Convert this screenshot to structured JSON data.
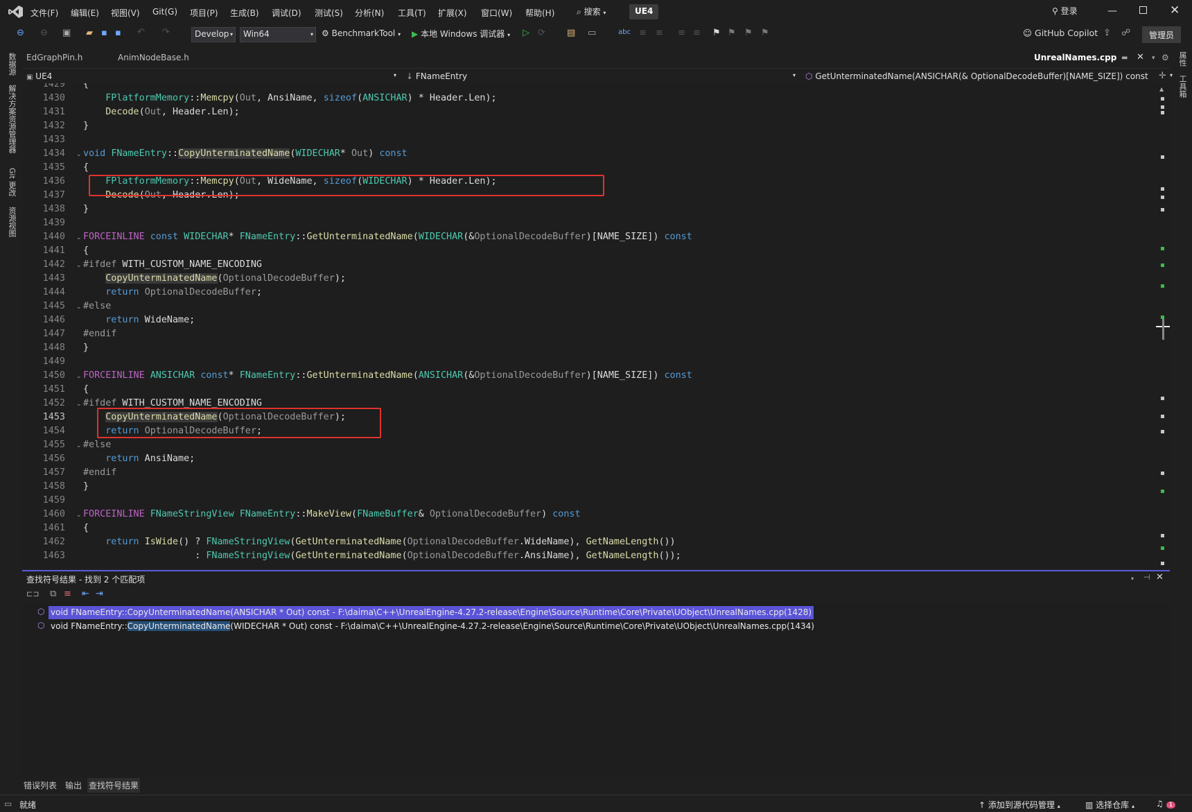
{
  "app": {
    "solution": "UE4"
  },
  "menu": [
    {
      "id": "file",
      "label": "文件(F)"
    },
    {
      "id": "edit",
      "label": "编辑(E)"
    },
    {
      "id": "view",
      "label": "视图(V)"
    },
    {
      "id": "git",
      "label": "Git(G)"
    },
    {
      "id": "project",
      "label": "项目(P)"
    },
    {
      "id": "build",
      "label": "生成(B)"
    },
    {
      "id": "debug",
      "label": "调试(D)"
    },
    {
      "id": "test",
      "label": "测试(S)"
    },
    {
      "id": "analyze",
      "label": "分析(N)"
    },
    {
      "id": "tools",
      "label": "工具(T)"
    },
    {
      "id": "extensions",
      "label": "扩展(X)"
    },
    {
      "id": "window",
      "label": "窗口(W)"
    },
    {
      "id": "help",
      "label": "帮助(H)"
    }
  ],
  "search": {
    "label": "搜索"
  },
  "account": {
    "signin_label": "登录",
    "admin_label": "管理员"
  },
  "toolbar": {
    "config": "Develop",
    "platform": "Win64",
    "startup_project": "BenchmarkTool",
    "run_label": "本地 Windows 调试器",
    "copilot_label": "GitHub Copilot"
  },
  "left_tabs": [
    "数据源",
    "解决方案资源管理器",
    "Git 更改",
    "资源视图"
  ],
  "right_tabs": [
    "属性",
    "工具箱"
  ],
  "doc_tabs": {
    "left": [
      "EdGraphPin.h",
      "AnimNodeBase.h"
    ],
    "active": "UnrealNames.cpp"
  },
  "navbar": {
    "project": "UE4",
    "scope": "FNameEntry",
    "member": "GetUnterminatedName(ANSICHAR(& OptionalDecodeBuffer)[NAME_SIZE]) const"
  },
  "editor": {
    "current_line": 1453,
    "lines": [
      {
        "n": 1429,
        "fold": false,
        "html": "{"
      },
      {
        "n": 1430,
        "fold": false,
        "html": "    <span class='ty'>FPlatformMemory</span>::<span class='fn'>Memcpy</span>(<span class='prm'>Out</span>, AnsiName, <span class='kw'>sizeof</span>(<span class='ty'>ANSICHAR</span>) * Header.Len);"
      },
      {
        "n": 1431,
        "fold": false,
        "html": "    <span class='fn'>Decode</span>(<span class='prm'>Out</span>, Header.Len);"
      },
      {
        "n": 1432,
        "fold": false,
        "html": "}"
      },
      {
        "n": 1433,
        "fold": false,
        "html": ""
      },
      {
        "n": 1434,
        "fold": true,
        "html": "<span class='kw'>void</span> <span class='ty'>FNameEntry</span>::<span class='fn hl'>CopyUnterminatedName</span>(<span class='ty'>WIDECHAR</span>* <span class='prm'>Out</span>) <span class='kw'>const</span>"
      },
      {
        "n": 1435,
        "fold": false,
        "html": "{"
      },
      {
        "n": 1436,
        "fold": false,
        "html": "    <span class='ty'>FPlatformMemory</span>::<span class='fn'>Memcpy</span>(<span class='prm'>Out</span>, WideName, <span class='kw'>sizeof</span>(<span class='ty'>WIDECHAR</span>) * Header.Len);"
      },
      {
        "n": 1437,
        "fold": false,
        "html": "    <span class='fn'>Decode</span>(<span class='prm'>Out</span>, Header.Len);"
      },
      {
        "n": 1438,
        "fold": false,
        "html": "}"
      },
      {
        "n": 1439,
        "fold": false,
        "html": ""
      },
      {
        "n": 1440,
        "fold": true,
        "html": "<span class='mac'>FORCEINLINE</span> <span class='kw'>const</span> <span class='ty'>WIDECHAR</span>* <span class='ty'>FNameEntry</span>::<span class='fn'>GetUnterminatedName</span>(<span class='ty'>WIDECHAR</span>(&amp;<span class='prm'>OptionalDecodeBuffer</span>)[NAME_SIZE]) <span class='kw'>const</span>"
      },
      {
        "n": 1441,
        "fold": false,
        "html": "{"
      },
      {
        "n": 1442,
        "fold": true,
        "html": "<span class='pp'>#ifdef</span> WITH_CUSTOM_NAME_ENCODING"
      },
      {
        "n": 1443,
        "fold": false,
        "html": "    <span class='fn hl'>CopyUnterminatedName</span>(<span class='prm'>OptionalDecodeBuffer</span>);"
      },
      {
        "n": 1444,
        "fold": false,
        "html": "    <span class='kw'>return</span> <span class='prm'>OptionalDecodeBuffer</span>;"
      },
      {
        "n": 1445,
        "fold": true,
        "html": "<span class='pp'>#else</span>"
      },
      {
        "n": 1446,
        "fold": false,
        "html": "    <span class='kw'>return</span> WideName;"
      },
      {
        "n": 1447,
        "fold": false,
        "html": "<span class='pp'>#endif</span>"
      },
      {
        "n": 1448,
        "fold": false,
        "html": "}"
      },
      {
        "n": 1449,
        "fold": false,
        "html": ""
      },
      {
        "n": 1450,
        "fold": true,
        "html": "<span class='mac'>FORCEINLINE</span> <span class='ty'>ANSICHAR</span> <span class='kw'>const</span>* <span class='ty'>FNameEntry</span>::<span class='fn'>GetUnterminatedName</span>(<span class='ty'>ANSICHAR</span>(&amp;<span class='prm'>OptionalDecodeBuffer</span>)[NAME_SIZE]) <span class='kw'>const</span>"
      },
      {
        "n": 1451,
        "fold": false,
        "html": "{"
      },
      {
        "n": 1452,
        "fold": true,
        "html": "<span class='pp'>#ifdef</span> WITH_CUSTOM_NAME_ENCODING"
      },
      {
        "n": 1453,
        "fold": false,
        "html": "    <span class='fn hl'>CopyUnterminatedName</span>(<span class='prm'>OptionalDecodeBuffer</span>);"
      },
      {
        "n": 1454,
        "fold": false,
        "html": "    <span class='kw'>return</span> <span class='prm'>OptionalDecodeBuffer</span>;"
      },
      {
        "n": 1455,
        "fold": true,
        "html": "<span class='pp'>#else</span>"
      },
      {
        "n": 1456,
        "fold": false,
        "html": "    <span class='kw'>return</span> AnsiName;"
      },
      {
        "n": 1457,
        "fold": false,
        "html": "<span class='pp'>#endif</span>"
      },
      {
        "n": 1458,
        "fold": false,
        "html": "}"
      },
      {
        "n": 1459,
        "fold": false,
        "html": ""
      },
      {
        "n": 1460,
        "fold": true,
        "html": "<span class='mac'>FORCEINLINE</span> <span class='ty'>FNameStringView</span> <span class='ty'>FNameEntry</span>::<span class='fn'>MakeView</span>(<span class='ty'>FNameBuffer</span>&amp; <span class='prm'>OptionalDecodeBuffer</span>) <span class='kw'>const</span>"
      },
      {
        "n": 1461,
        "fold": false,
        "html": "{"
      },
      {
        "n": 1462,
        "fold": false,
        "html": "    <span class='kw'>return</span> <span class='fn'>IsWide</span>() ? <span class='ty'>FNameStringView</span>(<span class='fn'>GetUnterminatedName</span>(<span class='prm'>OptionalDecodeBuffer</span>.WideName), <span class='fn'>GetNameLength</span>())"
      },
      {
        "n": 1463,
        "fold": false,
        "html": "                    : <span class='ty'>FNameStringView</span>(<span class='fn'>GetUnterminatedName</span>(<span class='prm'>OptionalDecodeBuffer</span>.AnsiName), <span class='fn'>GetNameLength</span>());"
      }
    ]
  },
  "find_panel": {
    "title": "查找符号结果 - 找到 2 个匹配项",
    "results": [
      {
        "pre": "void FNameEntry::CopyUnterminatedName(ANSICHAR * Out) const - F:\\daima\\C++\\UnrealEngine-4.27.2-release\\Engine\\Source\\Runtime\\Core\\Private\\UObject\\UnrealNames.cpp(1428)",
        "match": "",
        "post": "",
        "selected": true
      },
      {
        "pre": "void FNameEntry::",
        "match": "CopyUnterminatedName",
        "post": "(WIDECHAR * Out) const - F:\\daima\\C++\\UnrealEngine-4.27.2-release\\Engine\\Source\\Runtime\\Core\\Private\\UObject\\UnrealNames.cpp(1434)",
        "selected": false
      }
    ]
  },
  "bottom_tabs": [
    "错误列表",
    "输出",
    "查找符号结果"
  ],
  "status": {
    "ready": "就绪",
    "add_source_control": "添加到源代码管理",
    "select_repo": "选择仓库",
    "notifications": "1"
  },
  "colors": {
    "accent": "#5b54d6",
    "annotation": "#e0322f",
    "match": "#264f78"
  }
}
